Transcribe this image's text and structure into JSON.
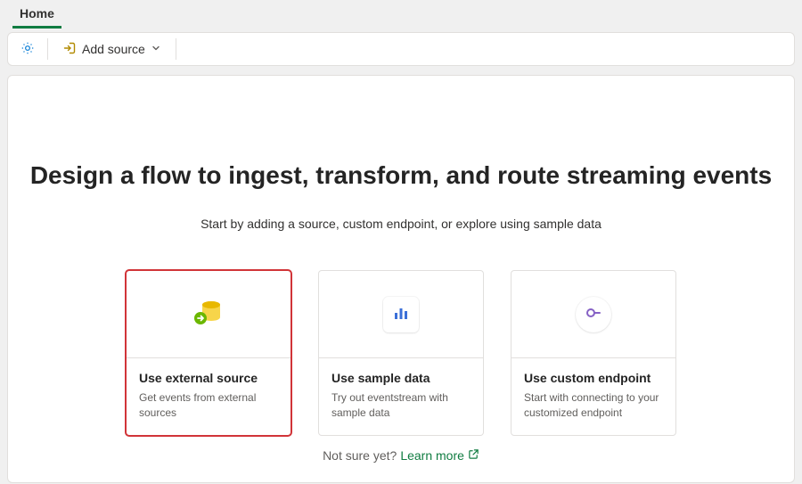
{
  "tabs": {
    "home": "Home"
  },
  "toolbar": {
    "add_source_label": "Add source"
  },
  "hero": {
    "headline": "Design a flow to ingest, transform, and route streaming events",
    "subhead": "Start by adding a source, custom endpoint, or explore using sample data"
  },
  "cards": [
    {
      "title": "Use external source",
      "desc": "Get events from external sources"
    },
    {
      "title": "Use sample data",
      "desc": "Try out eventstream with sample data"
    },
    {
      "title": "Use custom endpoint",
      "desc": "Start with connecting to your customized endpoint"
    }
  ],
  "footer": {
    "not_sure": "Not sure yet?",
    "learn_more": "Learn more"
  }
}
